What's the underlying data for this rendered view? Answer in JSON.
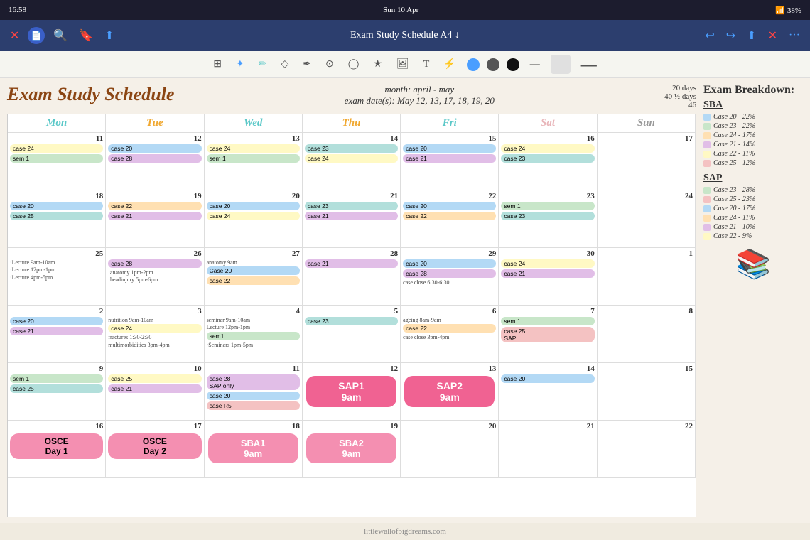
{
  "statusBar": {
    "time": "16:58",
    "date": "Sun 10 Apr",
    "wifi": "38%"
  },
  "toolbar": {
    "title": "Exam Study Schedule A4 ↓",
    "closeIcon": "✕",
    "backIcon": "↩",
    "forwardIcon": "↪",
    "dotsIcon": "···"
  },
  "calendar": {
    "title": "Exam Study Schedule",
    "monthLabel": "month: april - may",
    "examDates": "exam date(s): May 12, 13, 17, 18, 19, 20",
    "counts": "20 days\n40 ½ days\n46",
    "dayHeaders": [
      "Mon",
      "Tue",
      "Wed",
      "Thu",
      "Fri",
      "Sat",
      "Sun"
    ]
  },
  "sidebar": {
    "title": "Exam Breakdown:",
    "sba": {
      "label": "SBA",
      "items": [
        {
          "text": "Case 20 - 22%",
          "color": "#b3d9f5"
        },
        {
          "text": "Case 23 - 22%",
          "color": "#c8e6c9"
        },
        {
          "text": "Case 24 - 17%",
          "color": "#ffe0b2"
        },
        {
          "text": "Case 21 - 14%",
          "color": "#e1bee7"
        },
        {
          "text": "Case 22 - 11%",
          "color": "#fff9c4"
        },
        {
          "text": "Case 25 - 12%",
          "color": "#f4c2c2"
        }
      ]
    },
    "sap": {
      "label": "SAP",
      "items": [
        {
          "text": "Case 23 - 28%",
          "color": "#c8e6c9"
        },
        {
          "text": "Case 25 - 23%",
          "color": "#f4c2c2"
        },
        {
          "text": "Case 20 - 17%",
          "color": "#b3d9f5"
        },
        {
          "text": "Case 24 - 11%",
          "color": "#ffe0b2"
        },
        {
          "text": "Case 21 - 10%",
          "color": "#e1bee7"
        },
        {
          "text": "Case 22 - 9%",
          "color": "#fff9c4"
        }
      ]
    }
  },
  "footer": {
    "text": "littlewallofbigdreams.com"
  }
}
